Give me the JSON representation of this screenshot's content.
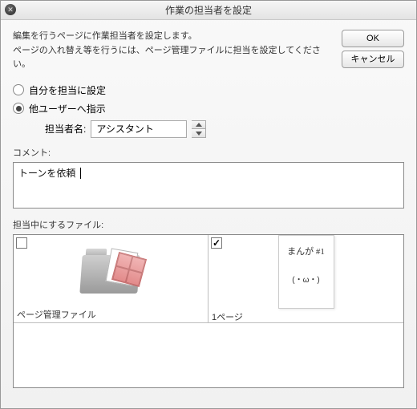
{
  "window": {
    "title": "作業の担当者を設定"
  },
  "description": {
    "line1": "編集を行うページに作業担当者を設定します。",
    "line2": "ページの入れ替え等を行うには、ページ管理ファイルに担当を設定してください。"
  },
  "buttons": {
    "ok": "OK",
    "cancel": "キャンセル"
  },
  "radios": {
    "self": "自分を担当に設定",
    "other": "他ユーザーへ指示",
    "selected": "other"
  },
  "assignee": {
    "label": "担当者名:",
    "value": "アシスタント"
  },
  "comment": {
    "label": "コメント:",
    "value": "トーンを依頼"
  },
  "files": {
    "label": "担当中にするファイル:",
    "items": [
      {
        "name": "ページ管理ファイル",
        "checked": false,
        "type": "folder"
      },
      {
        "name": "1ページ",
        "checked": true,
        "type": "page",
        "scribble": "まんが\n#1",
        "face": "(・ω・)"
      }
    ]
  }
}
